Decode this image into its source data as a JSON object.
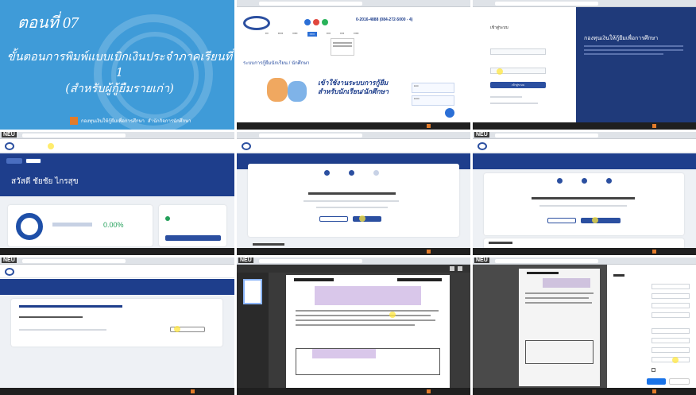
{
  "slide": {
    "episode": "ตอนที่ 07",
    "title_line1": "ขั้นตอนการพิมพ์แบบเบิกเงินประจำภาคเรียนที่ 1",
    "title_line2": "(สำหรับผู้กู้ยืมรายเก่า)",
    "org_left": "กองทุนเงินให้กู้ยืมเพื่อการศึกษา",
    "org_right": "สำนักกิจการนักศึกษา"
  },
  "site": {
    "hotline": "0-2016-4888 (084-272-5000 - 4)",
    "banner_line1": "เข้าใช้งานระบบการกู้ยืม",
    "banner_line2": "สำหรับนักเรียน/นักศึกษา",
    "section_title": "ระบบการกู้ยืมนักเรียน / นักศึกษา"
  },
  "login": {
    "heading": "เข้าสู่ระบบ",
    "button": "เข้าสู่ระบบ",
    "right_title": "กองทุนเงินให้กู้ยืมเพื่อการศึกษา"
  },
  "dashboard": {
    "greeting": "สวัสดี ชัยชัย ไกรสุข",
    "percent": "0.00%"
  },
  "neu_badge": "NEU",
  "accent": "#1e3e8c",
  "cursor_color": "#ffe63c"
}
